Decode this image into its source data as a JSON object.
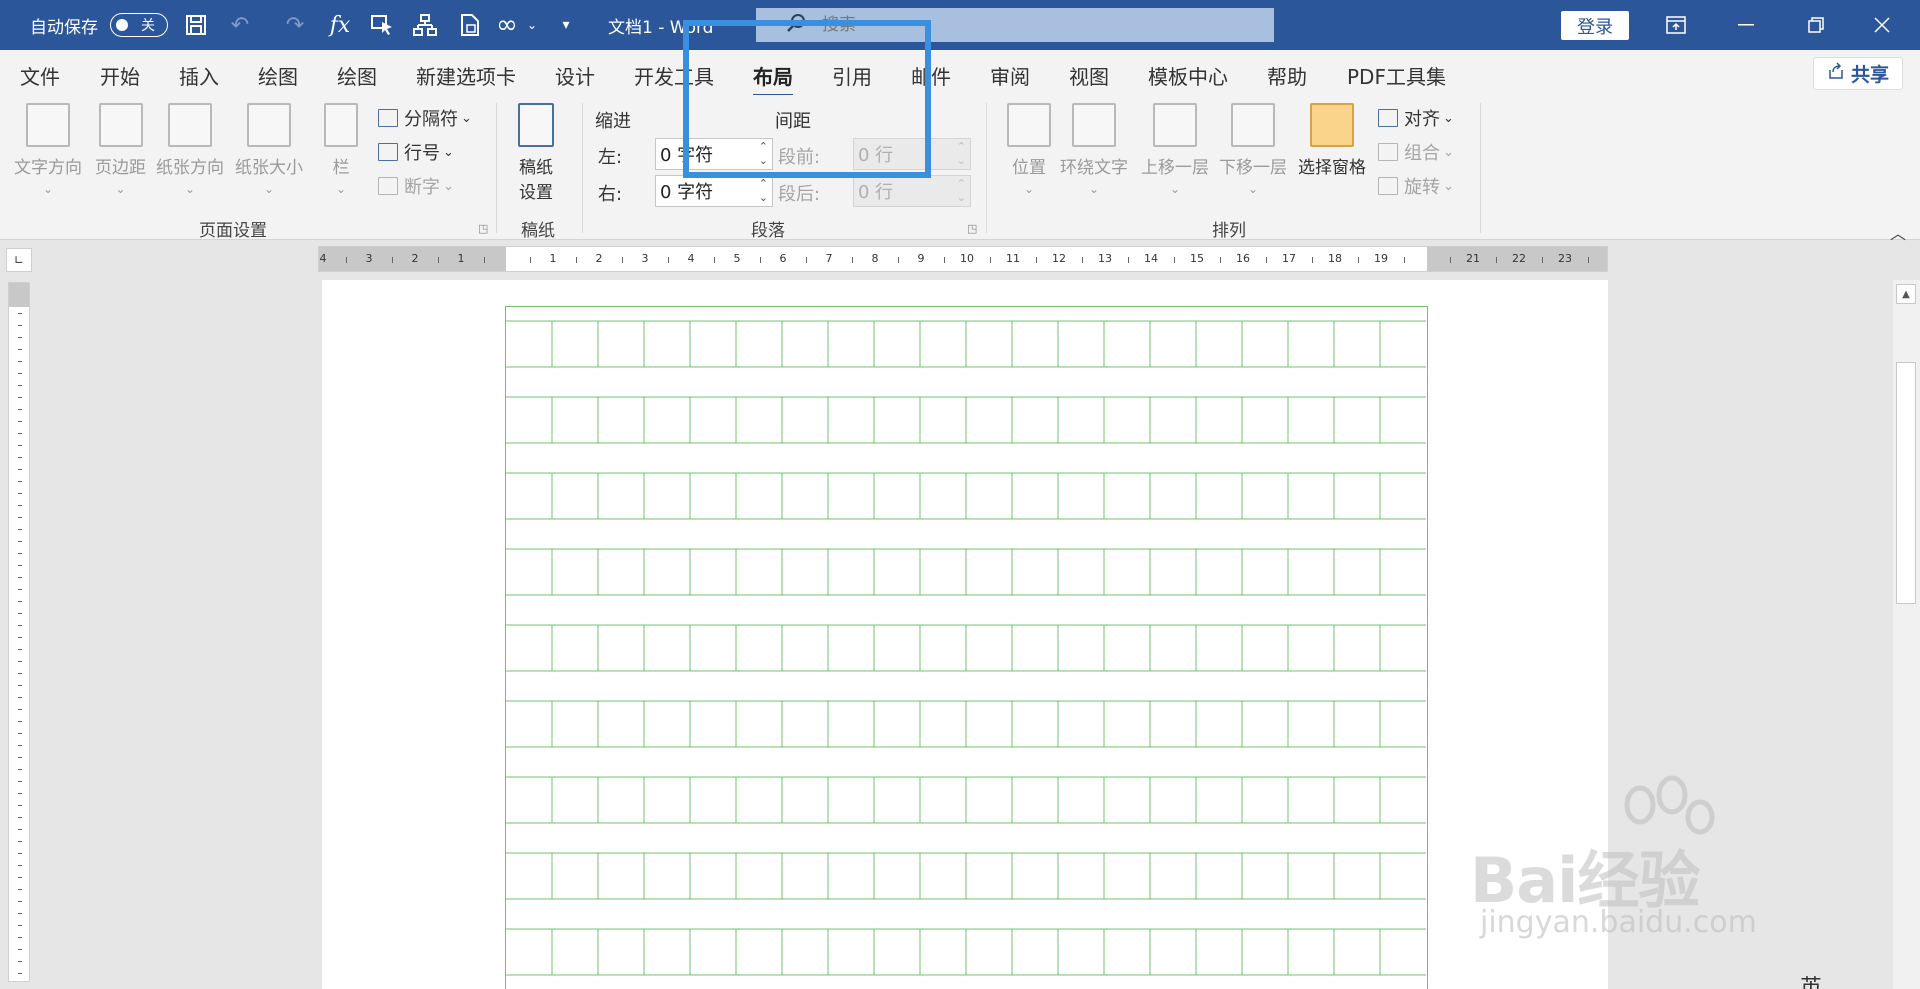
{
  "titlebar": {
    "autosave_label": "自动保存",
    "autosave_state": "关",
    "doc_title": "文档1  -  Word",
    "search_placeholder": "搜索",
    "login_label": "登录",
    "quick_access_icons": [
      "save-icon",
      "undo-icon",
      "redo-icon",
      "formula-icon",
      "select-icon",
      "org-chart-icon",
      "document-icon",
      "infinity-icon",
      "customize-icon"
    ]
  },
  "tabs": {
    "items": [
      "文件",
      "开始",
      "插入",
      "绘图",
      "绘图",
      "新建选项卡",
      "设计",
      "开发工具",
      "布局",
      "引用",
      "邮件",
      "审阅",
      "视图",
      "模板中心",
      "帮助",
      "PDF工具集"
    ],
    "active": "布局",
    "share_label": "共享"
  },
  "ribbon": {
    "page_setup": {
      "text_direction": "文字方向",
      "margins": "页边距",
      "orientation": "纸张方向",
      "size": "纸张大小",
      "columns": "栏",
      "breaks": "分隔符",
      "line_numbers": "行号",
      "hyphenation": "断字",
      "group_label": "页面设置"
    },
    "manuscript": {
      "button": "稿纸\n设置",
      "button_line1": "稿纸",
      "button_line2": "设置",
      "group_label": "稿纸"
    },
    "paragraph": {
      "indent_header": "缩进",
      "spacing_header": "间距",
      "left_label": "左:",
      "left_value": "0 字符",
      "right_label": "右:",
      "right_value": "0 字符",
      "before_label": "段前:",
      "before_value": "0 行",
      "after_label": "段后:",
      "after_value": "0 行",
      "group_label": "段落"
    },
    "arrange": {
      "position": "位置",
      "wrap_text": "环绕文字",
      "bring_forward": "上移一层",
      "send_backward": "下移一层",
      "selection_pane": "选择窗格",
      "align": "对齐",
      "group": "组合",
      "rotate": "旋转",
      "group_label": "排列"
    }
  },
  "ruler": {
    "numbers": [
      "4",
      "3",
      "2",
      "1",
      "",
      "1",
      "2",
      "3",
      "4",
      "5",
      "6",
      "7",
      "8",
      "9",
      "10",
      "11",
      "12",
      "13",
      "14",
      "15",
      "16",
      "17",
      "18",
      "19",
      "",
      "21",
      "22",
      "23"
    ]
  },
  "document": {
    "grid_columns": 20,
    "grid_rows": 9
  },
  "watermark": {
    "main": "Bai经验",
    "sub": "jingyan.baidu.com"
  },
  "statusbar": {
    "language": "英"
  }
}
